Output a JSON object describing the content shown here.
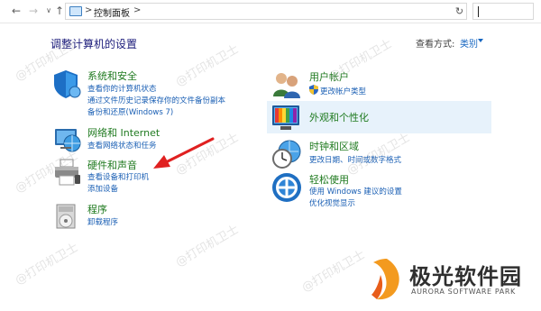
{
  "navigation": {
    "back_icon": "back-arrow-icon",
    "forward_icon": "forward-arrow-icon",
    "recent_icon": "chevron-down-icon",
    "up_icon": "up-arrow-icon"
  },
  "address_bar": {
    "separator_1": ">",
    "crumb": "控制面板",
    "separator_2": ">",
    "dropdown": "⌄",
    "refresh": "↻"
  },
  "search": {
    "placeholder": ""
  },
  "header": {
    "title": "调整计算机的设置",
    "view_by_label": "查看方式:",
    "view_by_value": "类别"
  },
  "categories": [
    {
      "title": "系统和安全",
      "links": [
        "查看你的计算机状态",
        "通过文件历史记录保存你的文件备份副本",
        "备份和还原(Windows 7)"
      ]
    },
    {
      "title": "网络和 Internet",
      "links": [
        "查看网络状态和任务"
      ]
    },
    {
      "title": "硬件和声音",
      "links": [
        "查看设备和打印机",
        "添加设备"
      ]
    },
    {
      "title": "程序",
      "links": [
        "卸载程序"
      ]
    },
    {
      "title": "用户帐户",
      "links": [
        "更改帐户类型"
      ]
    },
    {
      "title": "外观和个性化",
      "links": []
    },
    {
      "title": "时钟和区域",
      "links": [
        "更改日期、时间或数字格式"
      ]
    },
    {
      "title": "轻松使用",
      "links": [
        "使用 Windows 建议的设置",
        "优化视觉显示"
      ]
    }
  ],
  "watermark": "@打印机卫士",
  "brand": {
    "name_cn": "极光软件园",
    "name_en": "AURORA SOFTWARE PARK"
  },
  "colors": {
    "category_title": "#1f7a1f",
    "link": "#1a5fb4",
    "highlight": "#e7f2fb",
    "annotation_arrow": "#e02020"
  }
}
